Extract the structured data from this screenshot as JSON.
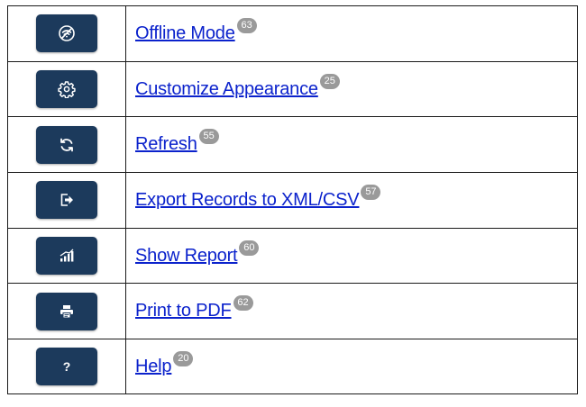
{
  "rows": [
    {
      "icon": "offline-wifi-icon",
      "label": "Offline Mode",
      "badge": "63"
    },
    {
      "icon": "gear-icon",
      "label": "Customize Appearance",
      "badge": "25"
    },
    {
      "icon": "refresh-icon",
      "label": "Refresh",
      "badge": "55"
    },
    {
      "icon": "export-icon",
      "label": "Export Records to XML/CSV",
      "badge": "57"
    },
    {
      "icon": "chart-icon",
      "label": "Show Report",
      "badge": "60"
    },
    {
      "icon": "printer-icon",
      "label": "Print to PDF",
      "badge": "62"
    },
    {
      "icon": "help-icon",
      "label": "Help",
      "badge": "20"
    }
  ],
  "colors": {
    "button_bg": "#1c3a5c",
    "link": "#0b22cc",
    "badge_bg": "#9a9a9a",
    "border": "#1a1a1a"
  }
}
